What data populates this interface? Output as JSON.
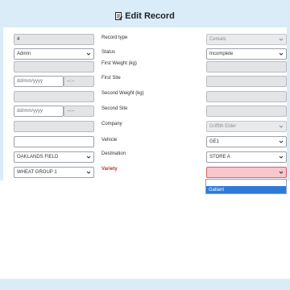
{
  "page": {
    "title": "Edit Record"
  },
  "left": {
    "id_value": "4",
    "user_role": "Admin",
    "first_site_date_ph": "dd/mm/yyyy",
    "first_site_time_ph": "--:--",
    "second_site_date_ph": "dd/mm/yyyy",
    "second_site_time_ph": "--:--",
    "field": "OAKLANDS FIELD",
    "group": "WHEAT GROUP 1"
  },
  "labels": {
    "record_type": "Record type",
    "status": "Status",
    "first_weight": "First Weight (kg)",
    "first_site": "First Site",
    "second_weight": "Second Weight (kg)",
    "second_site": "Second Site",
    "company": "Company",
    "vehicle": "Vehicle",
    "destination": "Destination",
    "variety": "Variety"
  },
  "right": {
    "record_type": "Cereals",
    "status": "Incomplete",
    "company": "Griffith Elder",
    "vehicle": "GE1",
    "destination": "STORE A",
    "variety": ""
  },
  "variety_options": [
    "",
    "Gallant"
  ]
}
